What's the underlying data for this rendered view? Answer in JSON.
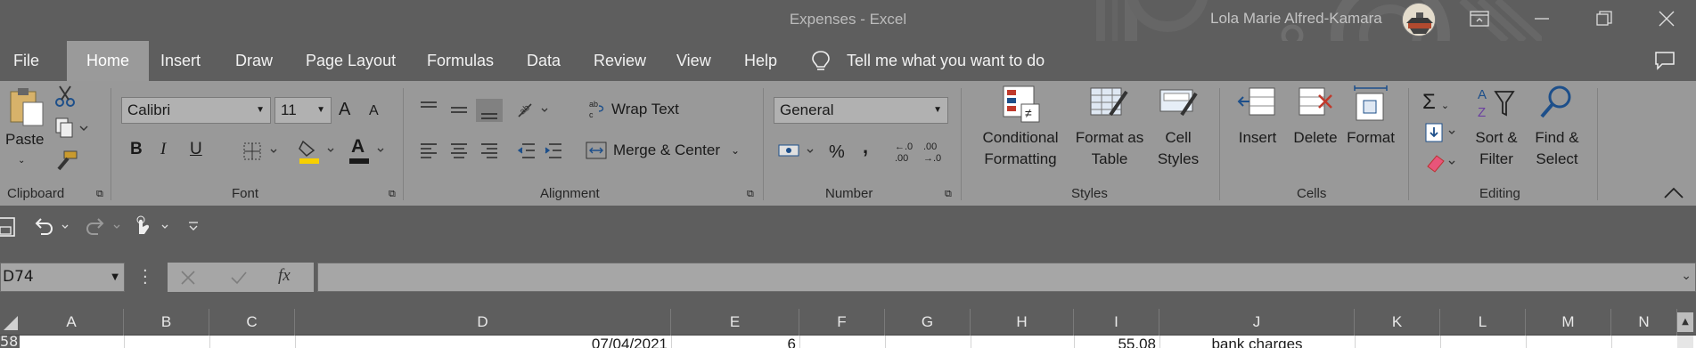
{
  "window": {
    "title": "Expenses  -  Excel",
    "user": "Lola Marie Alfred-Kamara"
  },
  "tabs": [
    {
      "label": "File"
    },
    {
      "label": "Home"
    },
    {
      "label": "Insert"
    },
    {
      "label": "Draw"
    },
    {
      "label": "Page Layout"
    },
    {
      "label": "Formulas"
    },
    {
      "label": "Data"
    },
    {
      "label": "Review"
    },
    {
      "label": "View"
    },
    {
      "label": "Help"
    }
  ],
  "tell_me": "Tell me what you want to do",
  "ribbon": {
    "clipboard": {
      "paste": "Paste",
      "label": "Clipboard"
    },
    "font": {
      "name": "Calibri",
      "size": "11",
      "label": "Font",
      "bold": "B",
      "italic": "I",
      "underline": "U",
      "grow": "A",
      "shrink": "A",
      "color": "A"
    },
    "alignment": {
      "wrap": "Wrap Text",
      "merge": "Merge & Center",
      "label": "Alignment"
    },
    "number": {
      "format": "General",
      "percent": "%",
      "comma": ",",
      "label": "Number"
    },
    "styles": {
      "conditional1": "Conditional",
      "conditional2": "Formatting",
      "table1": "Format as",
      "table2": "Table",
      "cell1": "Cell",
      "cell2": "Styles",
      "label": "Styles"
    },
    "cells": {
      "insert": "Insert",
      "delete": "Delete",
      "format": "Format",
      "label": "Cells"
    },
    "editing": {
      "sort1": "Sort &",
      "sort2": "Filter",
      "find1": "Find &",
      "find2": "Select",
      "label": "Editing"
    }
  },
  "formula_bar": {
    "name_box": "D74",
    "fx": "fx",
    "value": ""
  },
  "columns": [
    {
      "label": "A"
    },
    {
      "label": "B"
    },
    {
      "label": "C"
    },
    {
      "label": "D"
    },
    {
      "label": "E"
    },
    {
      "label": "F"
    },
    {
      "label": "G"
    },
    {
      "label": "H"
    },
    {
      "label": "I"
    },
    {
      "label": "J"
    },
    {
      "label": "K"
    },
    {
      "label": "L"
    },
    {
      "label": "M"
    },
    {
      "label": "N"
    }
  ],
  "row": {
    "number": "58",
    "d": "07/04/2021",
    "e": "6",
    "i": "55.08",
    "j": "bank charges"
  }
}
